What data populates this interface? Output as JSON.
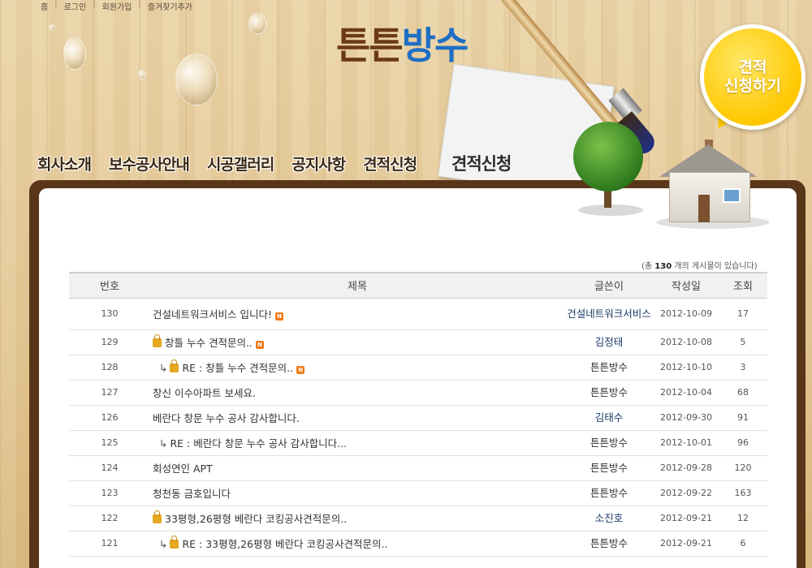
{
  "topbar": {
    "links": [
      "홈",
      "로그인",
      "회원가입",
      "즐겨찾기추가"
    ]
  },
  "logo": {
    "part1": "튼튼",
    "part2": "방수"
  },
  "cta": {
    "line1": "견적",
    "line2": "신청하기"
  },
  "nav": {
    "items": [
      "회사소개",
      "보수공사안내",
      "시공갤러리",
      "공지사항",
      "견적신청"
    ]
  },
  "page": {
    "heading": "견적신청"
  },
  "board": {
    "count_prefix": "(총",
    "count_value": "130",
    "count_suffix": "개의 게시물이 있습니다)",
    "columns": {
      "num": "번호",
      "subject": "제목",
      "author": "글쓴이",
      "date": "작성일",
      "hits": "조회"
    },
    "rows": [
      {
        "num": "130",
        "subject": "건설네트워크서비스 입니다!",
        "author": "건설네트워크서비스",
        "date": "2012-10-09",
        "hits": "17"
      },
      {
        "num": "129",
        "subject": "창틀 누수 견적문의..",
        "author": "김정태",
        "date": "2012-10-08",
        "hits": "5"
      },
      {
        "num": "128",
        "subject": "RE : 창틀 누수 견적문의..",
        "author": "튼튼방수",
        "date": "2012-10-10",
        "hits": "3"
      },
      {
        "num": "127",
        "subject": "창신 이수아파트 보세요.",
        "author": "튼튼방수",
        "date": "2012-10-04",
        "hits": "68"
      },
      {
        "num": "126",
        "subject": "베란다 창문 누수 공사 감사합니다.",
        "author": "김태수",
        "date": "2012-09-30",
        "hits": "91"
      },
      {
        "num": "125",
        "subject": "RE : 베란다 창문 누수 공사 감사합니다...",
        "author": "튼튼방수",
        "date": "2012-10-01",
        "hits": "96"
      },
      {
        "num": "124",
        "subject": "회성연인 APT",
        "author": "튼튼방수",
        "date": "2012-09-28",
        "hits": "120"
      },
      {
        "num": "123",
        "subject": "청천동 금호입니다",
        "author": "튼튼방수",
        "date": "2012-09-22",
        "hits": "163"
      },
      {
        "num": "122",
        "subject": "33평형,26평형 베란다 코킹공사견적문의..",
        "author": "소진호",
        "date": "2012-09-21",
        "hits": "12"
      },
      {
        "num": "121",
        "subject": "RE : 33평형,26평형 베란다 코킹공사견적문의..",
        "author": "튼튼방수",
        "date": "2012-09-21",
        "hits": "6"
      }
    ]
  },
  "icons": {
    "lock": "lock-icon",
    "new": "new-badge-icon",
    "reply": "reply-arrow-icon",
    "new_label": "N",
    "reply_glyph": "↳"
  }
}
